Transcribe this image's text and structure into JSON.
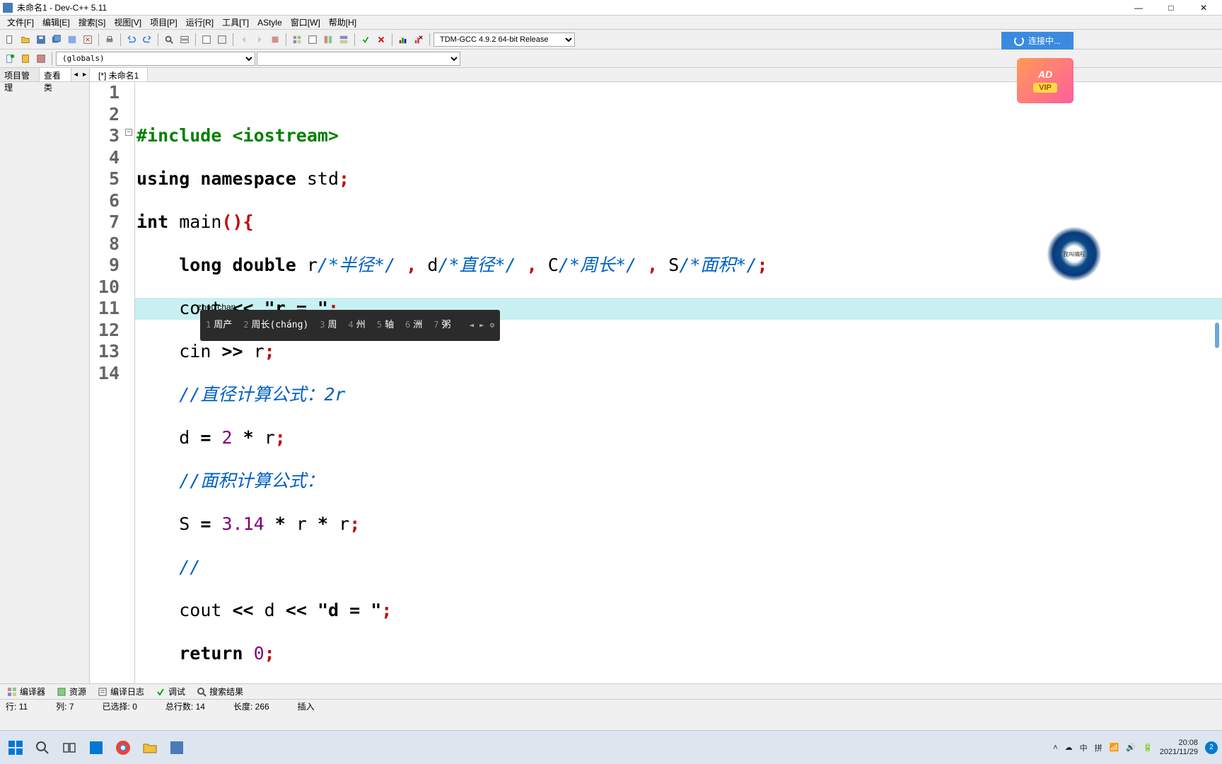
{
  "window": {
    "title": "未命名1 - Dev-C++ 5.11",
    "minimize": "—",
    "maximize": "□",
    "close": "✕"
  },
  "menu": {
    "file": "文件[F]",
    "edit": "编辑[E]",
    "search": "搜索[S]",
    "view": "视图[V]",
    "project": "项目[P]",
    "run": "运行[R]",
    "tools": "工具[T]",
    "astyle": "AStyle",
    "window": "窗口[W]",
    "help": "帮助[H]"
  },
  "toolbar": {
    "compiler_select": "TDM-GCC 4.9.2 64-bit Release"
  },
  "connecting": "连接中...",
  "ad": {
    "label": "AD",
    "vip": "VIP"
  },
  "scope": {
    "globals": "(globals)"
  },
  "side_tabs": {
    "project": "项目管理",
    "classes": "查看类"
  },
  "editor_tabs": {
    "tab1": "[*] 未命名1"
  },
  "code": {
    "line_numbers": [
      "1",
      "2",
      "3",
      "4",
      "5",
      "6",
      "7",
      "8",
      "9",
      "10",
      "11",
      "12",
      "13",
      "14"
    ],
    "l1_pp": "#include <iostream>",
    "l2_kw1": "using",
    "l2_kw2": "namespace",
    "l2_id": "std",
    "l3_kw1": "int",
    "l3_id": "main",
    "l4_kw": "long double",
    "l4_r": "r",
    "l4_c1": "/*半径*/",
    "l4_d": "d",
    "l4_c2": "/*直径*/",
    "l4_C": "C",
    "l4_c3": "/*周长*/",
    "l4_S": "S",
    "l4_c4": "/*面积*/",
    "l5_cout": "cout",
    "l5_op": "<<",
    "l5_str": "\"r = \"",
    "l6_cin": "cin",
    "l6_op": ">>",
    "l6_r": "r",
    "l7_cm": "//直径计算公式：2r",
    "l8_d": "d",
    "l8_eq": "=",
    "l8_2": "2",
    "l8_star": "*",
    "l8_r": "r",
    "l9_cm": "//面积计算公式：",
    "l10_S": "S",
    "l10_eq": "=",
    "l10_pi": "3.14",
    "l10_star": "*",
    "l10_r1": "r",
    "l10_r2": "r",
    "l11_cm": "//",
    "l12_cout": "cout",
    "l12_op": "<<",
    "l12_d": "d",
    "l12_str": "\"d = \"",
    "l13_kw": "return",
    "l13_z": "0"
  },
  "ime": {
    "composition": "zhou'chan",
    "candidates": [
      {
        "n": "1",
        "t": "周产"
      },
      {
        "n": "2",
        "t": "周长(cháng)"
      },
      {
        "n": "3",
        "t": "周"
      },
      {
        "n": "4",
        "t": "州"
      },
      {
        "n": "5",
        "t": "轴"
      },
      {
        "n": "6",
        "t": "洲"
      },
      {
        "n": "7",
        "t": "粥"
      }
    ]
  },
  "bottom_tabs": {
    "compiler": "编译器",
    "resources": "资源",
    "log": "编译日志",
    "debug": "调试",
    "search": "搜索结果"
  },
  "status": {
    "line_label": "行:",
    "line": "11",
    "col_label": "列:",
    "col": "7",
    "sel_label": "已选择:",
    "sel": "0",
    "total_label": "总行数:",
    "total": "14",
    "len_label": "长度:",
    "len": "266",
    "mode": "插入"
  },
  "taskbar": {
    "lang1": "中",
    "ime": "拼",
    "time": "20:08",
    "date": "2021/11/29",
    "notif": "2"
  }
}
